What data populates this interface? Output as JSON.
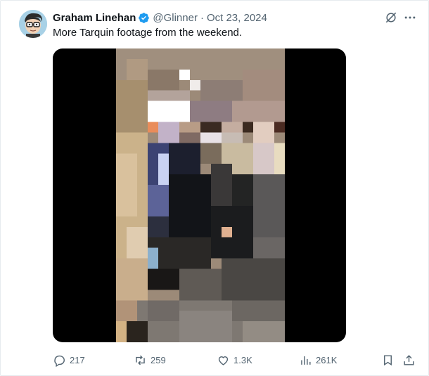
{
  "author": {
    "name": "Graham Linehan",
    "handle": "@Glinner",
    "separator": "·",
    "date": "Oct 23, 2024",
    "verified": true,
    "avatar": "avatar-illustration"
  },
  "tweet": {
    "text": "More Tarquin footage from the weekend.",
    "media": "pixelated-video"
  },
  "header_icons": [
    "grok-icon",
    "more-icon"
  ],
  "actions": {
    "replies": "217",
    "reposts": "259",
    "likes": "1.3K",
    "views": "261K"
  },
  "colors": {
    "text": "#0f1419",
    "secondary": "#536471",
    "verified": "#1d9bf0",
    "media_bg": "#000000"
  }
}
